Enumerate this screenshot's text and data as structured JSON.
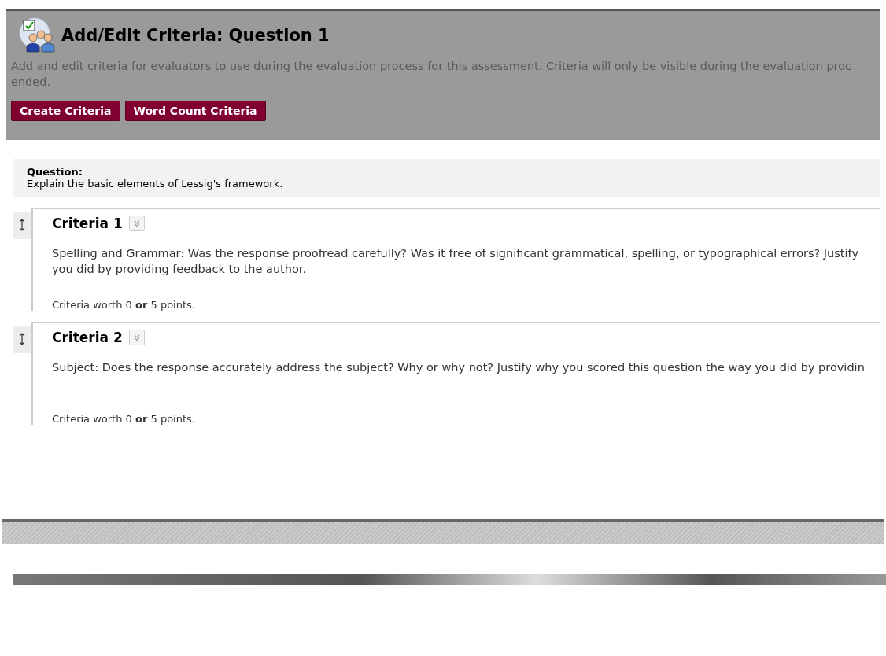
{
  "header": {
    "title": "Add/Edit Criteria: Question 1",
    "description": "Add and edit criteria for evaluators to use during the evaluation process for this assessment. Criteria will only be visible during the evaluation proc",
    "description_end": "ended.",
    "buttons": [
      "Create Criteria",
      "Word Count Criteria"
    ]
  },
  "question": {
    "label": "Question:",
    "text": "Explain the basic elements of Lessig's framework."
  },
  "criteria": [
    {
      "title": "Criteria 1",
      "lines": [
        "Spelling and Grammar: Was the response proofread carefully? Was it free of significant grammatical, spelling, or typographical errors? Justify",
        "you did by providing feedback to the author."
      ],
      "worth": "Criteria worth 0 **or** 5 points."
    },
    {
      "title": "Criteria 2",
      "lines": [
        "Subject: Does the response accurately address the subject? Why or why not? Justify why you scored this question the way you did by providin"
      ],
      "worth": "Criteria worth 0 **or** 5 points."
    }
  ]
}
